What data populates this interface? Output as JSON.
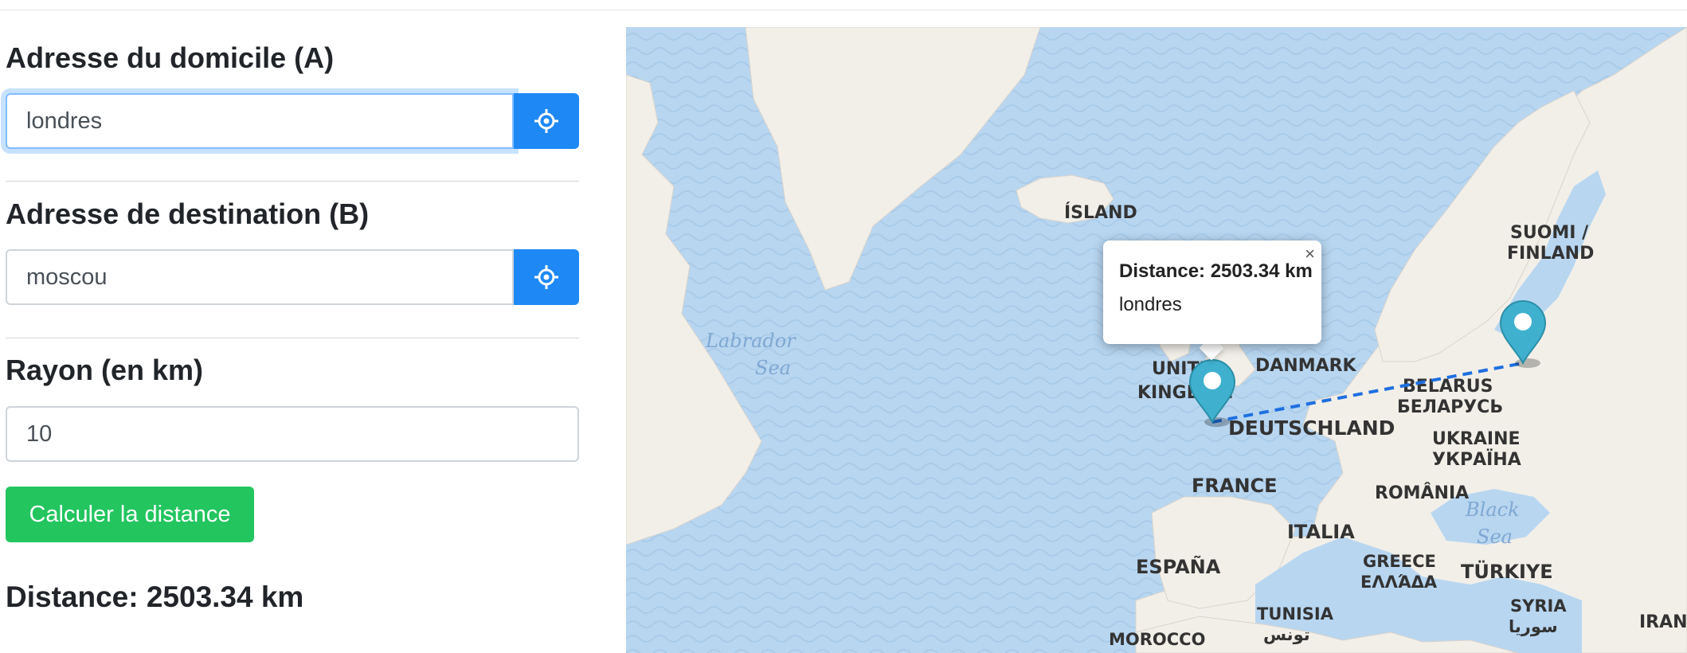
{
  "form": {
    "home_label": "Adresse du domicile (A)",
    "home_value": "londres",
    "dest_label": "Adresse de destination (B)",
    "dest_value": "moscou",
    "radius_label": "Rayon (en km)",
    "radius_value": "10",
    "calc_button": "Calculer la distance",
    "result_text": "Distance: 2503.34 km"
  },
  "colors": {
    "primary": "#1e88f5",
    "success": "#22c55e",
    "sea": "#b8d6f0",
    "land": "#f2efe9",
    "marker": "#3fb1ce",
    "route": "#1e6fe0"
  },
  "icons": {
    "locate": "crosshair-icon",
    "marker": "map-marker-icon",
    "close": "close-icon"
  },
  "map": {
    "popup": {
      "distance": "Distance: 2503.34 km",
      "place": "londres",
      "close": "×"
    },
    "labels": {
      "island": "ÍSLAND",
      "finland_1": "SUOMI /",
      "finland_2": "FINLAND",
      "labrador_1": "Labrador",
      "labrador_2": "Sea",
      "uk_1": "UNITED",
      "uk_2": "KINGDOM",
      "danmark": "DANMARK",
      "belarus_1": "BELARUS",
      "belarus_2": "БЕЛАРУСЬ",
      "deutschland": "DEUTSCHLAND",
      "ukraine_1": "UKRAINE",
      "ukraine_2": "УКРАЇНА",
      "france": "FRANCE",
      "romania": "ROMÂNIA",
      "black_sea_1": "Black",
      "black_sea_2": "Sea",
      "italia": "ITALIA",
      "espana": "ESPAÑA",
      "greece_1": "GREECE",
      "greece_2": "ΕΛΛΆΔΑ",
      "turkiye": "TÜRKIYE",
      "tunisia_1": "TUNISIA",
      "tunisia_2": "تونس",
      "syria_1": "SYRIA",
      "syria_2": "سوريا",
      "morocco": "MOROCCO",
      "iran": "IRAN"
    }
  }
}
